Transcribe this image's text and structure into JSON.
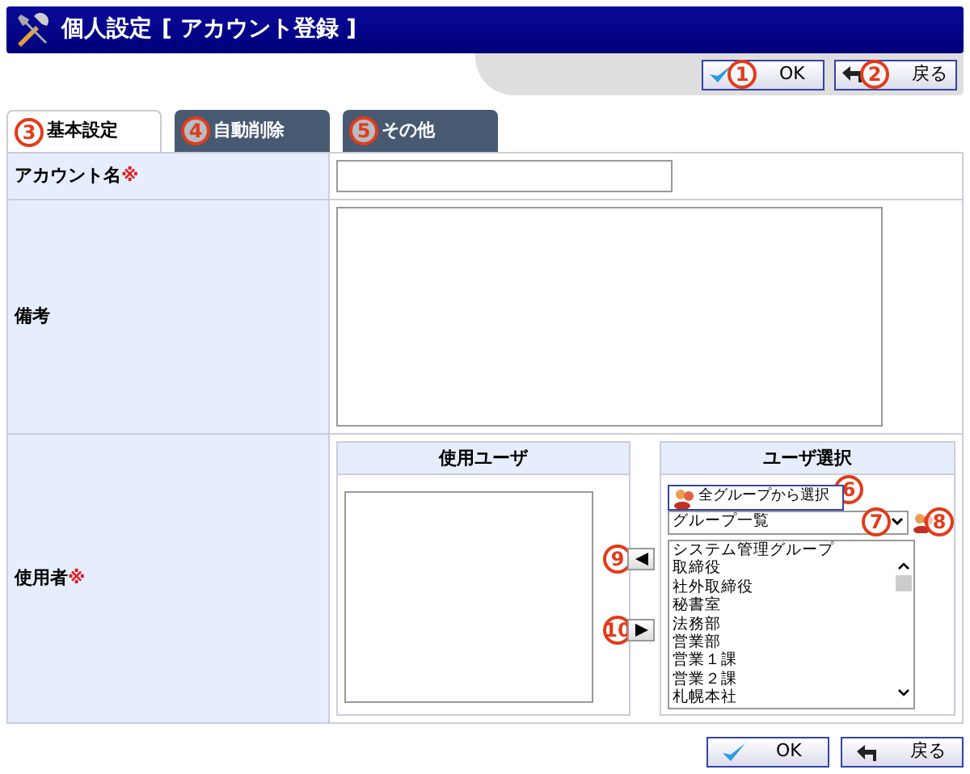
{
  "window": {
    "title": "個人設定",
    "subtitle": "[ アカウント登録 ]"
  },
  "toolbar_buttons": [
    {
      "label": "OK",
      "kind": "ok",
      "callout": "1"
    },
    {
      "label": "戻る",
      "kind": "back",
      "callout": "2"
    }
  ],
  "tabs": [
    {
      "label": "基本設定",
      "selected": true,
      "callout": "3"
    },
    {
      "label": "自動削除",
      "selected": false,
      "callout": "4"
    },
    {
      "label": "その他",
      "selected": false,
      "callout": "5"
    }
  ],
  "form": {
    "account_name": {
      "label": "アカウント名",
      "required_mark": "※"
    },
    "memo": {
      "label": "備考"
    },
    "users": {
      "label": "使用者",
      "required_mark": "※",
      "used_users": {
        "heading": "使用ユーザ"
      },
      "add_button_callout": "9",
      "remove_button_callout": "10",
      "user_select": {
        "heading": "ユーザ選択",
        "select_all_button": {
          "label": "全グループから選択",
          "callout": "6"
        },
        "group_dropdown": {
          "value": "グループ一覧",
          "callout": "7"
        },
        "group_icon_callout": "8",
        "groups": [
          "システム管理グループ",
          "取締役",
          "社外取締役",
          "秘書室",
          "法務部",
          "営業部",
          "営業１課",
          "営業２課",
          "札幌本社"
        ]
      }
    }
  },
  "bottom_buttons": [
    {
      "label": "OK",
      "kind": "ok"
    },
    {
      "label": "戻る",
      "kind": "back"
    }
  ]
}
